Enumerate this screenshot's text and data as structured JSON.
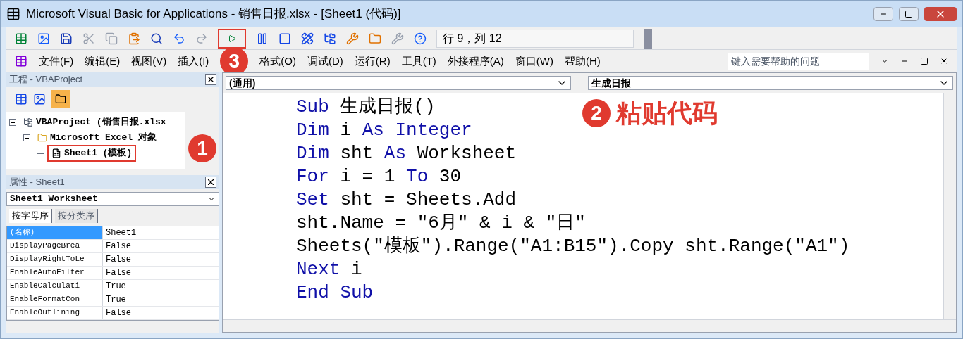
{
  "window": {
    "title": "Microsoft Visual Basic for Applications - 销售日报.xlsx - [Sheet1 (代码)]"
  },
  "toolbar": {
    "position": "行 9，列 12",
    "run_marked": true,
    "badge": "3"
  },
  "menu": {
    "items": [
      "文件(F)",
      "编辑(E)",
      "视图(V)",
      "插入(I)",
      "格式(O)",
      "调试(D)",
      "运行(R)",
      "工具(T)",
      "外接程序(A)",
      "窗口(W)",
      "帮助(H)"
    ],
    "help_placeholder": "键入需要帮助的问题"
  },
  "project": {
    "title": "工程 - VBAProject",
    "badge": "1",
    "tree": [
      {
        "label": "VBAProject (销售日报.xlsx",
        "marked": false,
        "expanded": true,
        "children": [
          {
            "label": "Microsoft Excel 对象",
            "marked": false,
            "expanded": true,
            "children": [
              {
                "label": "Sheet1 (模板)",
                "marked": true
              }
            ]
          }
        ]
      }
    ]
  },
  "properties": {
    "title": "属性 - Sheet1",
    "object": "Sheet1 Worksheet",
    "tabs": [
      {
        "label": "按字母序",
        "selected": true
      },
      {
        "label": "按分类序",
        "selected": false
      }
    ],
    "rows": [
      {
        "name": "(名称)",
        "value": "Sheet1",
        "selected": true
      },
      {
        "name": "DisplayPageBrea",
        "value": "False",
        "selected": false
      },
      {
        "name": "DisplayRightToLe",
        "value": "False",
        "selected": false
      },
      {
        "name": "EnableAutoFilter",
        "value": "False",
        "selected": false
      },
      {
        "name": "EnableCalculati",
        "value": "True",
        "selected": false
      },
      {
        "name": "EnableFormatCon",
        "value": "True",
        "selected": false
      },
      {
        "name": "EnableOutlining",
        "value": "False",
        "selected": false
      }
    ]
  },
  "code": {
    "object": "(通用)",
    "procedure": "生成日报",
    "annotation": {
      "badge": "2",
      "text": "粘贴代码"
    },
    "lines": [
      [
        {
          "text": "Sub",
          "kind": "keyword"
        },
        {
          "text": " 生成日报()",
          "kind": "plain"
        }
      ],
      [
        {
          "text": "Dim",
          "kind": "keyword"
        },
        {
          "text": " i ",
          "kind": "plain"
        },
        {
          "text": "As",
          "kind": "keyword"
        },
        {
          "text": " Integer",
          "kind": "keyword"
        }
      ],
      [
        {
          "text": "Dim",
          "kind": "keyword"
        },
        {
          "text": " sht ",
          "kind": "plain"
        },
        {
          "text": "As",
          "kind": "keyword"
        },
        {
          "text": " Worksheet",
          "kind": "plain"
        }
      ],
      [
        {
          "text": "For",
          "kind": "keyword"
        },
        {
          "text": " i = 1 ",
          "kind": "plain"
        },
        {
          "text": "To",
          "kind": "keyword"
        },
        {
          "text": " 30",
          "kind": "plain"
        }
      ],
      [
        {
          "text": "Set",
          "kind": "keyword"
        },
        {
          "text": " sht = Sheets.Add",
          "kind": "plain"
        }
      ],
      [
        {
          "text": "sht.Name = \"6月\" & i & \"日\"",
          "kind": "plain"
        }
      ],
      [
        {
          "text": "Sheets(\"模板\").Range(\"A1:B15\").Copy sht.Range(\"A1\")",
          "kind": "plain"
        }
      ],
      [
        {
          "text": "Next",
          "kind": "keyword"
        },
        {
          "text": " i",
          "kind": "plain"
        }
      ],
      [
        {
          "text": "End Sub",
          "kind": "keyword"
        }
      ]
    ]
  }
}
